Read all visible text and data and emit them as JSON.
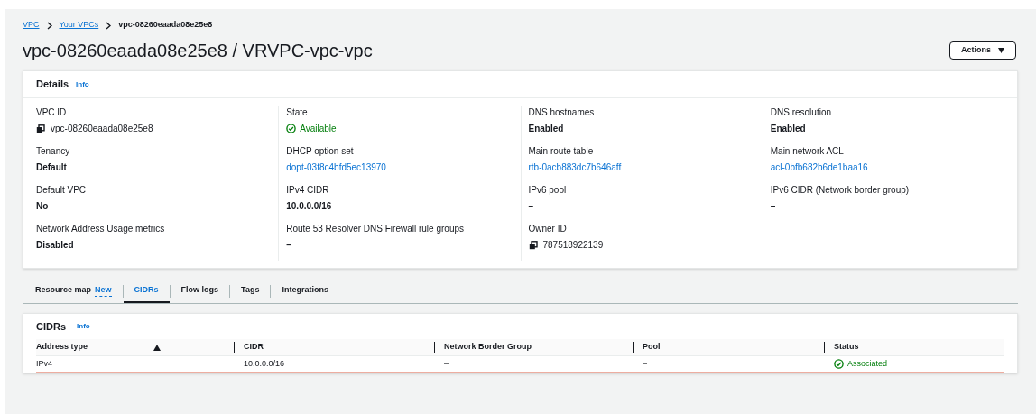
{
  "breadcrumbs": [
    {
      "label": "VPC",
      "kind": "link"
    },
    {
      "label": "Your VPCs",
      "kind": "link"
    },
    {
      "label": "vpc-08260eaada08e25e8",
      "kind": "current"
    }
  ],
  "title": "vpc-08260eaada08e25e8 / VRVPC-vpc-vpc",
  "actions_button": {
    "label": "Actions"
  },
  "details": {
    "title": "Details",
    "info": "Info",
    "columns": [
      [
        {
          "label": "VPC ID",
          "value": "vpc-08260eaada08e25e8",
          "kind": "copy"
        },
        {
          "label": "Tenancy",
          "value": "Default",
          "kind": "text"
        },
        {
          "label": "Default VPC",
          "value": "No",
          "kind": "text"
        },
        {
          "label": "Network Address Usage metrics",
          "value": "Disabled",
          "kind": "text"
        }
      ],
      [
        {
          "label": "State",
          "value": "Available",
          "kind": "status"
        },
        {
          "label": "DHCP option set",
          "value": "dopt-03f8c4bfd5ec13970",
          "kind": "link"
        },
        {
          "label": "IPv4 CIDR",
          "value": "10.0.0.0/16",
          "kind": "text"
        },
        {
          "label": "Route 53 Resolver DNS Firewall rule groups",
          "value": "–",
          "kind": "text"
        }
      ],
      [
        {
          "label": "DNS hostnames",
          "value": "Enabled",
          "kind": "text"
        },
        {
          "label": "Main route table",
          "value": "rtb-0acb883dc7b646aff",
          "kind": "link"
        },
        {
          "label": "IPv6 pool",
          "value": "–",
          "kind": "text"
        },
        {
          "label": "Owner ID",
          "value": "787518922139",
          "kind": "copy"
        }
      ],
      [
        {
          "label": "DNS resolution",
          "value": "Enabled",
          "kind": "text"
        },
        {
          "label": "Main network ACL",
          "value": "acl-0bfb682b6de1baa16",
          "kind": "link"
        },
        {
          "label": "IPv6 CIDR (Network border group)",
          "value": "–",
          "kind": "text"
        }
      ]
    ]
  },
  "tabs": [
    {
      "label": "Resource map",
      "badge": "New",
      "selected": false
    },
    {
      "label": "CIDRs",
      "selected": true
    },
    {
      "label": "Flow logs",
      "selected": false
    },
    {
      "label": "Tags",
      "selected": false
    },
    {
      "label": "Integrations",
      "selected": false
    }
  ],
  "cidrs": {
    "title": "CIDRs",
    "info": "Info",
    "columns": [
      {
        "label": "Address type",
        "sorted": true
      },
      {
        "label": "CIDR",
        "sorted": false
      },
      {
        "label": "Network Border Group",
        "sorted": false
      },
      {
        "label": "Pool",
        "sorted": false
      },
      {
        "label": "Status",
        "sorted": false
      }
    ],
    "rows": [
      [
        {
          "value": "IPv4",
          "kind": "text"
        },
        {
          "value": "10.0.0.0/16",
          "kind": "text"
        },
        {
          "value": "–",
          "kind": "text"
        },
        {
          "value": "–",
          "kind": "text"
        },
        {
          "value": "Associated",
          "kind": "status"
        }
      ]
    ]
  }
}
